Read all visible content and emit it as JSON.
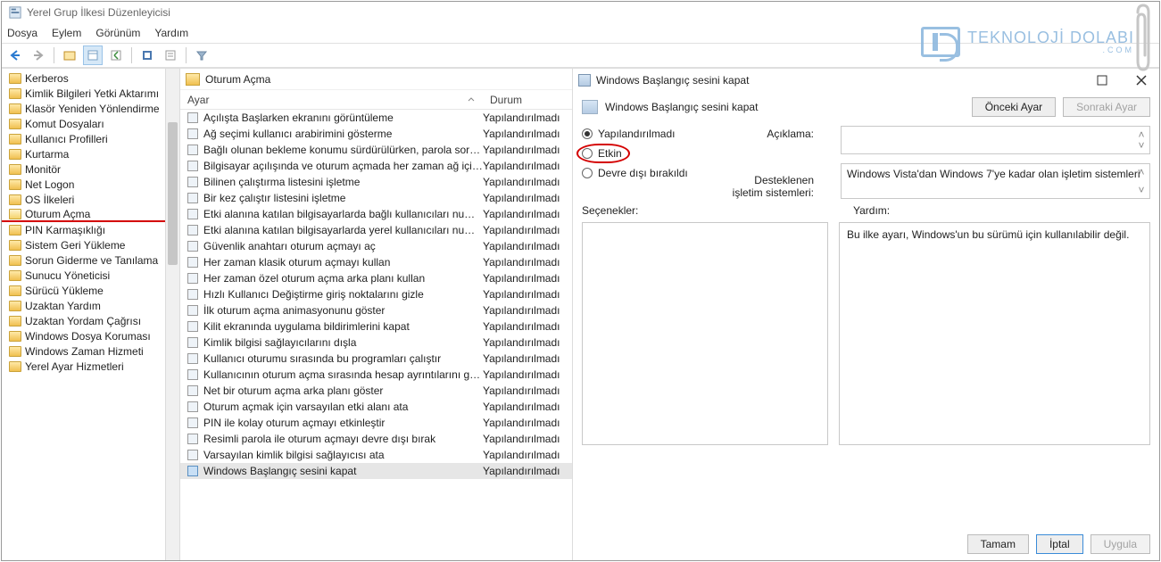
{
  "window_title": "Yerel Grup İlkesi Düzenleyicisi",
  "menubar": {
    "file": "Dosya",
    "action": "Eylem",
    "view": "Görünüm",
    "help": "Yardım"
  },
  "tree": {
    "items": [
      "Kerberos",
      "Kimlik Bilgileri Yetki Aktarımı",
      "Klasör Yeniden Yönlendirme",
      "Komut Dosyaları",
      "Kullanıcı Profilleri",
      "Kurtarma",
      "Monitör",
      "Net Logon",
      "OS İlkeleri",
      "Oturum Açma",
      "PIN Karmaşıklığı",
      "Sistem Geri Yükleme",
      "Sorun Giderme ve Tanılama",
      "Sunucu Yöneticisi",
      "Sürücü Yükleme",
      "Uzaktan Yardım",
      "Uzaktan Yordam Çağrısı",
      "Windows Dosya Koruması",
      "Windows Zaman Hizmeti",
      "Yerel Ayar Hizmetleri"
    ],
    "selected_index": 9,
    "underline_index": 9
  },
  "list": {
    "header_title": "Oturum Açma",
    "col_name": "Ayar",
    "col_state": "Durum",
    "state_value": "Yapılandırılmadı",
    "rows": [
      "Açılışta Başlarken ekranını görüntüleme",
      "Ağ seçimi kullanıcı arabirimini gösterme",
      "Bağlı olunan bekleme konumu sürdürülürken, parola sorul...",
      "Bilgisayar açılışında ve oturum açmada her zaman ağ için be...",
      "Bilinen çalıştırma listesini işletme",
      "Bir kez çalıştır listesini işletme",
      "Etki alanına katılan bilgisayarlarda bağlı kullanıcıları numaral...",
      "Etki alanına katılan bilgisayarlarda yerel kullanıcıları numaral...",
      "Güvenlik anahtarı oturum açmayı aç",
      "Her zaman klasik oturum açmayı kullan",
      "Her zaman özel oturum açma arka planı kullan",
      "Hızlı Kullanıcı Değiştirme giriş noktalarını gizle",
      "İlk oturum açma animasyonunu göster",
      "Kilit ekranında uygulama bildirimlerini kapat",
      "Kimlik bilgisi sağlayıcılarını dışla",
      "Kullanıcı oturumu sırasında bu programları çalıştır",
      "Kullanıcının oturum açma sırasında hesap ayrıntılarını göste...",
      "Net bir oturum açma arka planı göster",
      "Oturum açmak için varsayılan etki alanı ata",
      "PIN ile kolay oturum açmayı etkinleştir",
      "Resimli parola ile oturum açmayı devre dışı bırak",
      "Varsayılan kimlik bilgisi sağlayıcısı ata",
      "Windows Başlangıç sesini kapat"
    ],
    "selected_index": 22,
    "underline_index": 22
  },
  "dialog": {
    "title": "Windows Başlangıç sesini kapat",
    "subtitle": "Windows Başlangıç sesini kapat",
    "prev_btn": "Önceki Ayar",
    "next_btn": "Sonraki Ayar",
    "radios": {
      "not_configured": "Yapılandırılmadı",
      "enabled": "Etkin",
      "disabled": "Devre dışı bırakıldı"
    },
    "labels": {
      "comment": "Açıklama:",
      "supported": "Desteklenen işletim sistemleri:",
      "options": "Seçenekler:",
      "help": "Yardım:"
    },
    "supported_text": "Windows Vista'dan Windows 7'ye kadar olan işletim sistemleri",
    "help_text": "Bu ilke ayarı, Windows'un bu sürümü için kullanılabilir değil.",
    "buttons": {
      "ok": "Tamam",
      "cancel": "İptal",
      "apply": "Uygula"
    }
  },
  "watermark": {
    "brand": "TEKNOLOJİ DOLABI",
    "sub": ".COM"
  }
}
